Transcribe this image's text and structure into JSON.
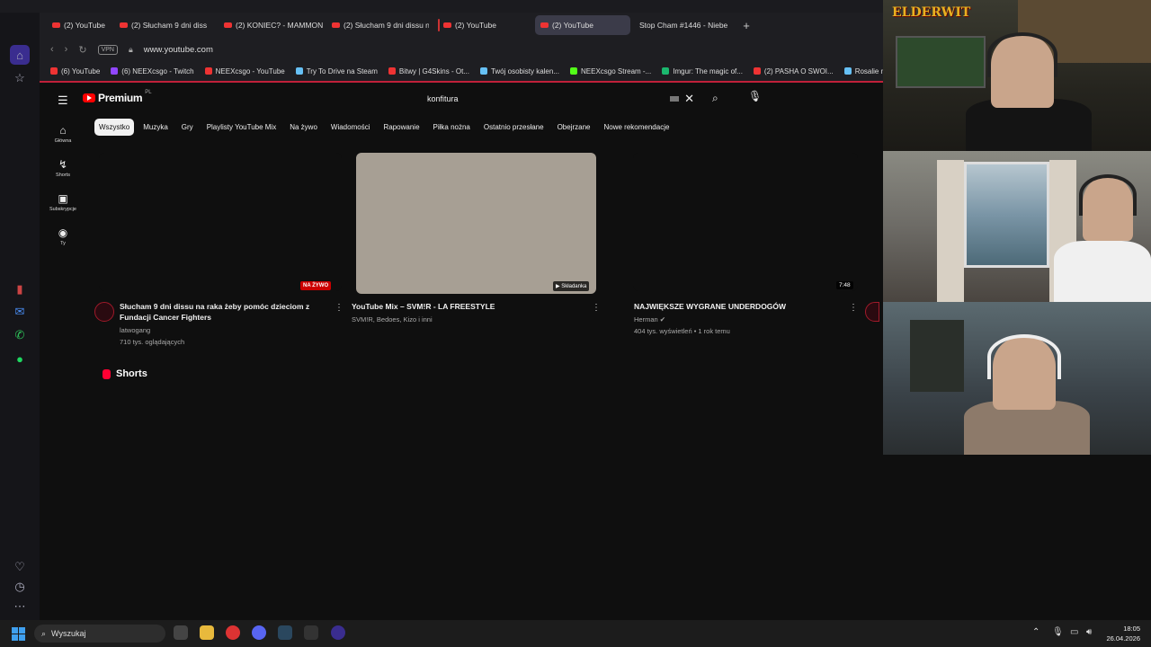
{
  "browser": {
    "tabs": [
      {
        "label": "(2) YouTube",
        "active": false
      },
      {
        "label": "(2) Słucham 9 dni diss",
        "active": false
      },
      {
        "label": "(2) KONIEC? - MAMMON",
        "active": false
      },
      {
        "label": "(2) Słucham 9 dni dissu n",
        "active": false
      },
      {
        "label": "(2) YouTube",
        "active": false
      },
      {
        "label": "(2) YouTube",
        "active": true
      },
      {
        "label": "Stop Cham #1446 - Niebe",
        "active": false
      }
    ],
    "vpn_label": "VPN",
    "url": "www.youtube.com",
    "bookmarks": [
      {
        "label": "(6) YouTube",
        "color": "#e33"
      },
      {
        "label": "(6) NEEXcsgo - Twitch",
        "color": "#9146ff"
      },
      {
        "label": "NEEXcsgo - YouTube",
        "color": "#e33"
      },
      {
        "label": "Try To Drive na Steam",
        "color": "#66c0f4"
      },
      {
        "label": "Bitwy | G4Skins - Ot...",
        "color": "#e33"
      },
      {
        "label": "Twój osobisty kalen...",
        "color": "#66c0f4"
      },
      {
        "label": "NEEXcsgo Stream -...",
        "color": "#53fc18"
      },
      {
        "label": "Imgur: The magic of...",
        "color": "#1bb76e"
      },
      {
        "label": "(2) PASHA O SWOI...",
        "color": "#e33"
      },
      {
        "label": "Rosalie na Steam",
        "color": "#66c0f4"
      }
    ]
  },
  "youtube": {
    "logo_text": "Premium",
    "logo_region": "PL",
    "search_query": "konfitura",
    "chips": [
      "Wszystko",
      "Muzyka",
      "Gry",
      "Playlisty YouTube Mix",
      "Na żywo",
      "Wiadomości",
      "Rapowanie",
      "Piłka nożna",
      "Ostatnio przesłane",
      "Obejrzane",
      "Nowe rekomendacje"
    ],
    "guide": [
      {
        "label": "Główna",
        "icon": "home-icon"
      },
      {
        "label": "Shorts",
        "icon": "shorts-icon"
      },
      {
        "label": "Subskrypcje",
        "icon": "subscriptions-icon"
      },
      {
        "label": "Ty",
        "icon": "you-icon"
      }
    ],
    "videos": [
      {
        "title": "Słucham 9 dni dissu na raka żeby pomóc dzieciom z Fundacji Cancer Fighters",
        "channel": "latwogang",
        "meta": "710 tys. oglądających",
        "badge": "NA ŻYWO"
      },
      {
        "title": "YouTube Mix – SVM!R - LA FREESTYLE",
        "channel": "SVM!R, Bedoes, Kizo i inni",
        "meta": "",
        "badge": "Składanka"
      },
      {
        "title": "NAJWIĘKSZE WYGRANE UNDERDOGÓW",
        "channel": "Herman",
        "meta": "404 tys. wyświetleń • 1 rok temu",
        "badge": "7:48"
      }
    ],
    "shorts_heading": "Shorts"
  },
  "stream": {
    "overlay_logo": "ELDERWIT"
  },
  "taskbar": {
    "search_placeholder": "Wyszukaj",
    "time": "18:05",
    "date": "26.04.2026"
  }
}
